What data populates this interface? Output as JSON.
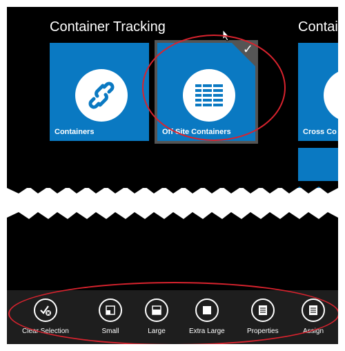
{
  "groups": [
    {
      "title": "Container Tracking"
    },
    {
      "title": "Contai"
    }
  ],
  "tiles": [
    {
      "label": "Containers",
      "icon": "link-icon"
    },
    {
      "label": "Off Site Containers",
      "icon": "list-grid-icon",
      "selected": true
    },
    {
      "label": "Cross Co",
      "icon": "list-grid-icon"
    }
  ],
  "appbar": {
    "commands": [
      {
        "label": "Clear Selection",
        "icon": "clear-selection-icon"
      },
      {
        "label": "Small",
        "icon": "small-tile-icon"
      },
      {
        "label": "Large",
        "icon": "large-tile-icon"
      },
      {
        "label": "Extra Large",
        "icon": "extra-large-tile-icon"
      },
      {
        "label": "Properties",
        "icon": "properties-icon"
      },
      {
        "label": "Assign",
        "icon": "assign-icon"
      }
    ]
  },
  "colors": {
    "tile": "#0a79c2",
    "annotation": "#d9232e",
    "background": "#000000",
    "appbar": "#1e1e1e"
  }
}
